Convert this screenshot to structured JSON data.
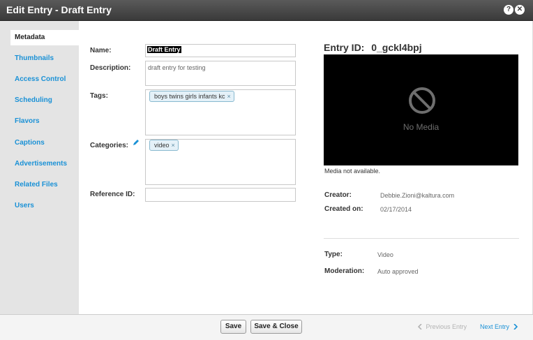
{
  "window": {
    "title": "Edit Entry - Draft Entry",
    "help_icon": "?",
    "close_icon": "✕"
  },
  "sidebar": {
    "items": [
      {
        "label": "Metadata",
        "active": true
      },
      {
        "label": "Thumbnails"
      },
      {
        "label": "Access Control"
      },
      {
        "label": "Scheduling"
      },
      {
        "label": "Flavors"
      },
      {
        "label": "Captions"
      },
      {
        "label": "Advertisements"
      },
      {
        "label": "Related Files"
      },
      {
        "label": "Users"
      }
    ]
  },
  "form": {
    "name_label": "Name:",
    "name_value": "Draft Entry",
    "description_label": "Description:",
    "description_value": "draft entry for testing",
    "tags_label": "Tags:",
    "tags": [
      "boys twins girls infants kc"
    ],
    "categories_label": "Categories:",
    "categories": [
      "video"
    ],
    "reference_label": "Reference ID:",
    "reference_value": "",
    "tag_remove_icon": "×"
  },
  "preview": {
    "entry_id_label": "Entry ID:",
    "entry_id": "0_gckl4bpj",
    "no_media_text": "No Media",
    "media_status": "Media not available."
  },
  "info": {
    "creator_label": "Creator:",
    "creator_value": "Debbie.Zioni@kaltura.com",
    "created_on_label": "Created on:",
    "created_on_value": "02/17/2014",
    "type_label": "Type:",
    "type_value": "Video",
    "moderation_label": "Moderation:",
    "moderation_value": "Auto approved"
  },
  "footer": {
    "save_label": "Save",
    "save_close_label": "Save & Close",
    "prev_label": "Previous Entry",
    "next_label": "Next Entry"
  },
  "colors": {
    "link": "#1a91d6",
    "titlebar": "#3a3a3a",
    "tag_bg": "#e4f1f8"
  }
}
